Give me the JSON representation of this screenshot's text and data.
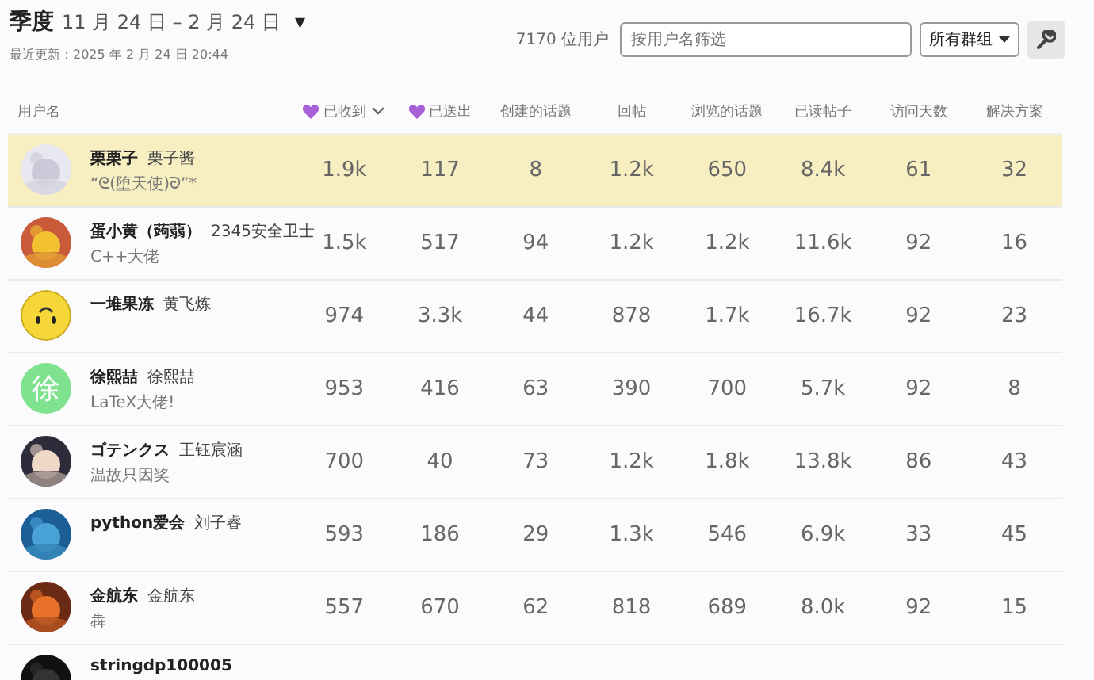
{
  "header": {
    "period": "季度",
    "range": "11 月 24 日 – 2 月 24 日",
    "caret": "▾",
    "updated": "最近更新：2025 年 2 月 24 日 20:44",
    "user_count": "7170 位用户",
    "filter": {
      "placeholder": "按用户名筛选"
    },
    "group_select": "所有群组"
  },
  "table": {
    "columns": [
      {
        "label": "用户名",
        "kind": "plain"
      },
      {
        "label": "已收到",
        "kind": "heart",
        "sorted": true
      },
      {
        "label": "已送出",
        "kind": "heart",
        "sorted": false
      },
      {
        "label": "创建的话题",
        "kind": "plain"
      },
      {
        "label": "回帖",
        "kind": "plain"
      },
      {
        "label": "浏览的话题",
        "kind": "plain"
      },
      {
        "label": "已读帖子",
        "kind": "plain"
      },
      {
        "label": "访问天数",
        "kind": "plain"
      },
      {
        "label": "解决方案",
        "kind": "plain"
      }
    ],
    "rows": [
      {
        "username": "栗栗子",
        "name": "栗子酱",
        "title": "“ᘓ(堕天使)ᘐ”*",
        "avatar": {
          "kind": "picture"
        },
        "selected": true,
        "values": [
          "1.9k",
          "117",
          "8",
          "1.2k",
          "650",
          "8.4k",
          "61",
          "32"
        ]
      },
      {
        "username": "蛋小黄（蒟蒻）",
        "name": "2345安全卫士",
        "title": "C++大佬",
        "avatar": {
          "kind": "picture"
        },
        "selected": false,
        "values": [
          "1.5k",
          "517",
          "94",
          "1.2k",
          "1.2k",
          "11.6k",
          "92",
          "16"
        ]
      },
      {
        "username": "一堆果冻",
        "name": "黄飞炼",
        "avatar": {
          "kind": "smiley"
        },
        "selected": false,
        "values": [
          "974",
          "3.3k",
          "44",
          "878",
          "1.7k",
          "16.7k",
          "92",
          "23"
        ]
      },
      {
        "username": "徐熙喆",
        "name": "徐熙喆",
        "title": "LaTeX大佬!",
        "avatar": {
          "kind": "letter",
          "letter": "徐",
          "color": "#7fe28e"
        },
        "selected": false,
        "values": [
          "953",
          "416",
          "63",
          "390",
          "700",
          "5.7k",
          "92",
          "8"
        ]
      },
      {
        "username": "ゴテンクス",
        "name": "王钰宸涵",
        "title": "温故只因奖",
        "avatar": {
          "kind": "picture"
        },
        "selected": false,
        "values": [
          "700",
          "40",
          "73",
          "1.2k",
          "1.8k",
          "13.8k",
          "86",
          "43"
        ]
      },
      {
        "username": "python爱会",
        "name": "刘子睿",
        "avatar": {
          "kind": "picture"
        },
        "selected": false,
        "values": [
          "593",
          "186",
          "29",
          "1.3k",
          "546",
          "6.9k",
          "33",
          "45"
        ]
      },
      {
        "username": "金航东",
        "name": "金航东",
        "title": "犇",
        "avatar": {
          "kind": "picture"
        },
        "selected": false,
        "values": [
          "557",
          "670",
          "62",
          "818",
          "689",
          "8.0k",
          "92",
          "15"
        ]
      },
      {
        "username": "stringdp100005",
        "avatar": {
          "kind": "picture"
        },
        "selected": false,
        "values": []
      }
    ]
  }
}
